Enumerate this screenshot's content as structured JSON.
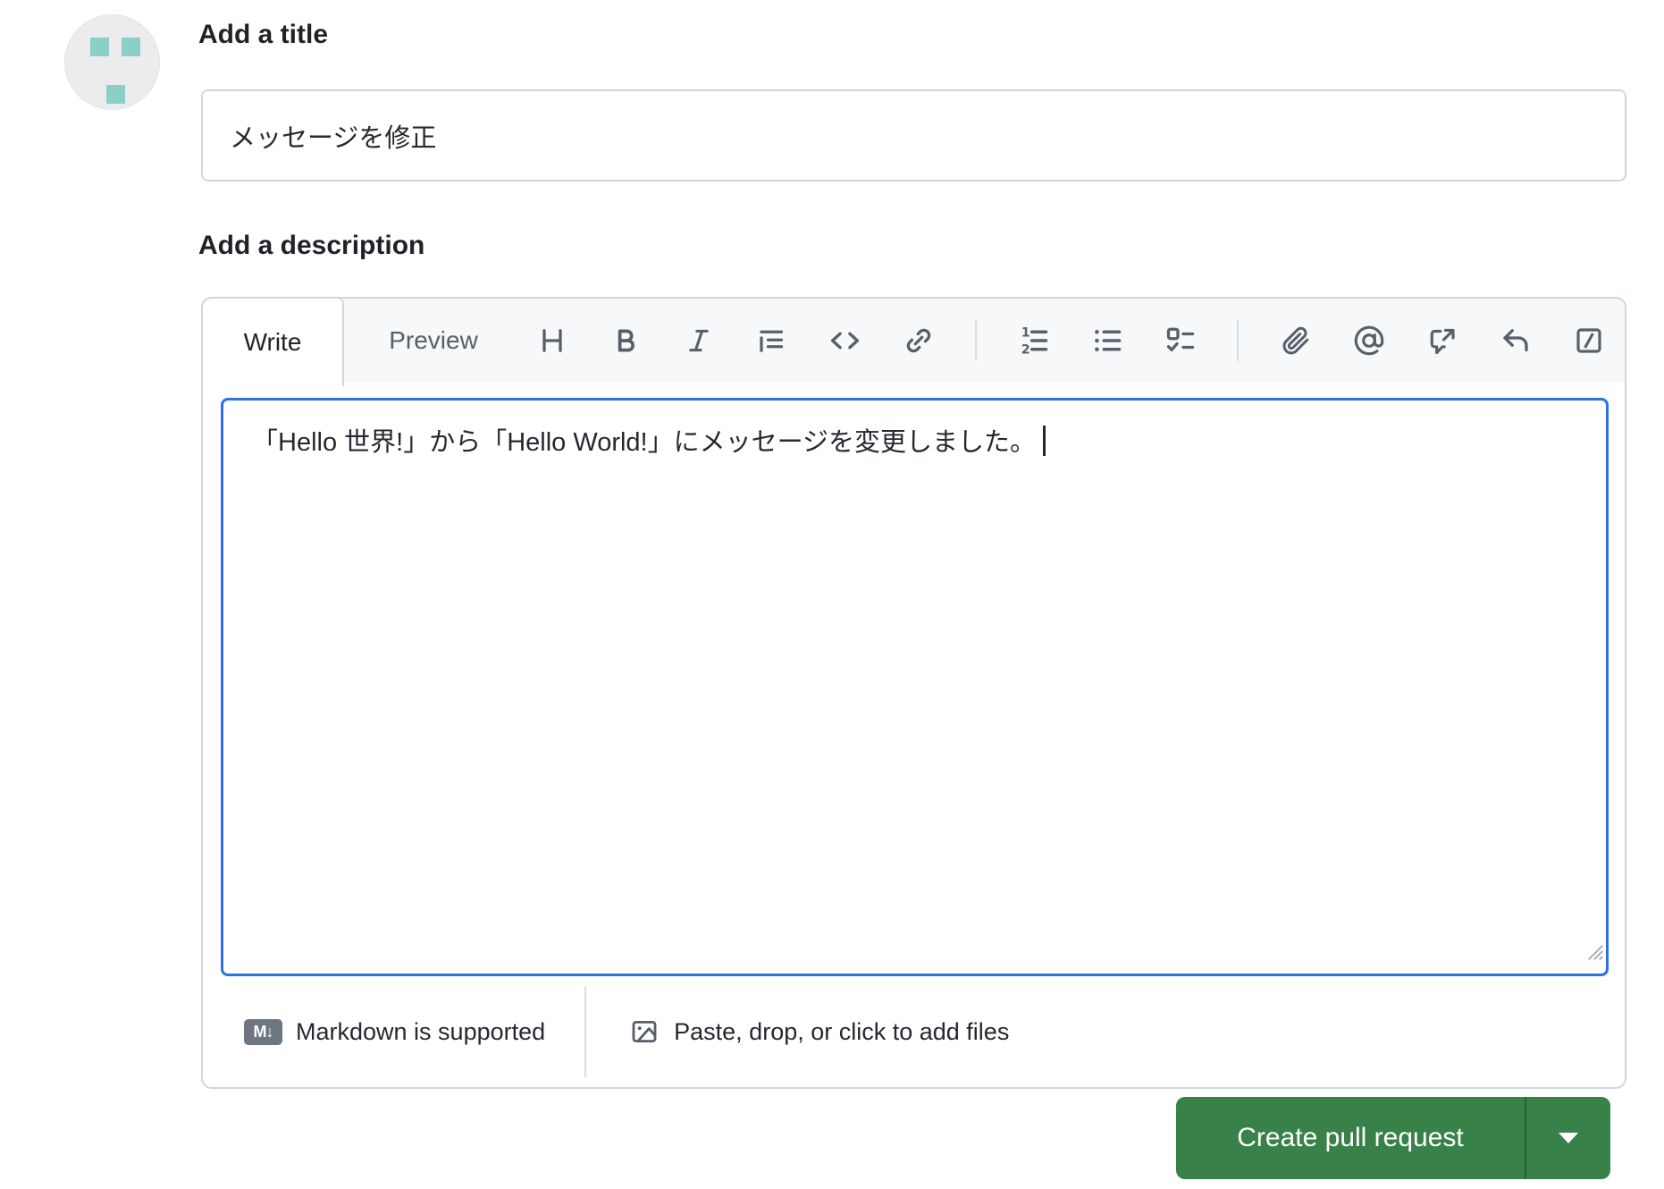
{
  "avatar": {
    "kind": "identicon",
    "background": "#ececec",
    "square_color": "#8ad0c9"
  },
  "title_section": {
    "label": "Add a title",
    "value": "メッセージを修正"
  },
  "description_section": {
    "label": "Add a description",
    "tabs": [
      {
        "label": "Write",
        "active": true
      },
      {
        "label": "Preview",
        "active": false
      }
    ],
    "toolbar_icons": [
      "heading",
      "bold",
      "italic",
      "quote",
      "code",
      "link",
      "ordered-list",
      "unordered-list",
      "task-list",
      "attach",
      "mention",
      "cross-reference",
      "reply",
      "saved-replies"
    ],
    "body_text": "「Hello 世界!」から「Hello World!」にメッセージを変更しました。",
    "footer": {
      "markdown_badge": "M↓",
      "markdown_hint": "Markdown is supported",
      "attach_hint": "Paste, drop, or click to add files"
    }
  },
  "actions": {
    "create_pull_request_label": "Create pull request"
  },
  "colors": {
    "button_green": "#38824a",
    "focus_blue": "#2f6fe0",
    "border_gray": "#d0d7de",
    "header_gray": "#f6f8fa",
    "icon_gray": "#57606a",
    "text_dark": "#24292f",
    "avatar_teal": "#8ad0c9"
  }
}
